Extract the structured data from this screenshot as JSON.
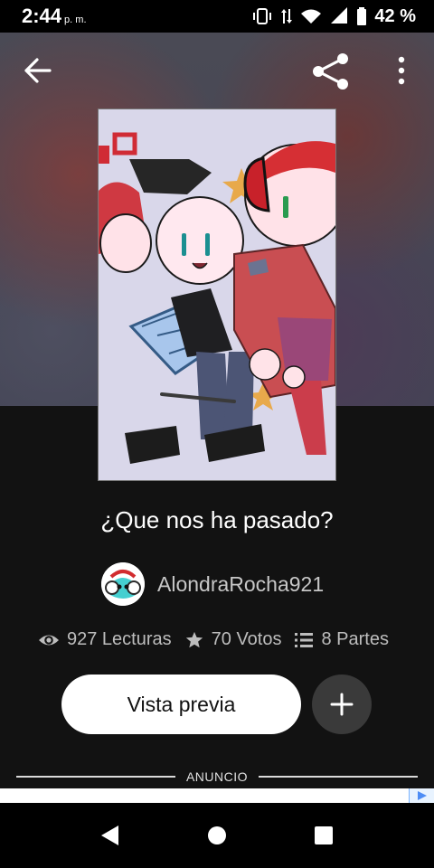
{
  "status_bar": {
    "time": "2:44",
    "time_suffix": "p. m.",
    "battery": "42 %"
  },
  "story": {
    "title": "¿Que nos ha pasado?",
    "author": "AlondraRocha921",
    "stats": {
      "reads": "927 Lecturas",
      "votes": "70 Votos",
      "parts": "8 Partes"
    }
  },
  "actions": {
    "preview_label": "Vista previa",
    "add_label": "+"
  },
  "ad": {
    "label": "ANUNCIO"
  },
  "icons": {
    "back": "arrow-left-icon",
    "share": "share-icon",
    "more": "more-vertical-icon",
    "eye": "eye-icon",
    "star": "star-icon",
    "list": "list-icon",
    "plus": "plus-icon",
    "nav_back": "nav-back-icon",
    "nav_home": "nav-home-icon",
    "nav_recent": "nav-recent-icon"
  }
}
